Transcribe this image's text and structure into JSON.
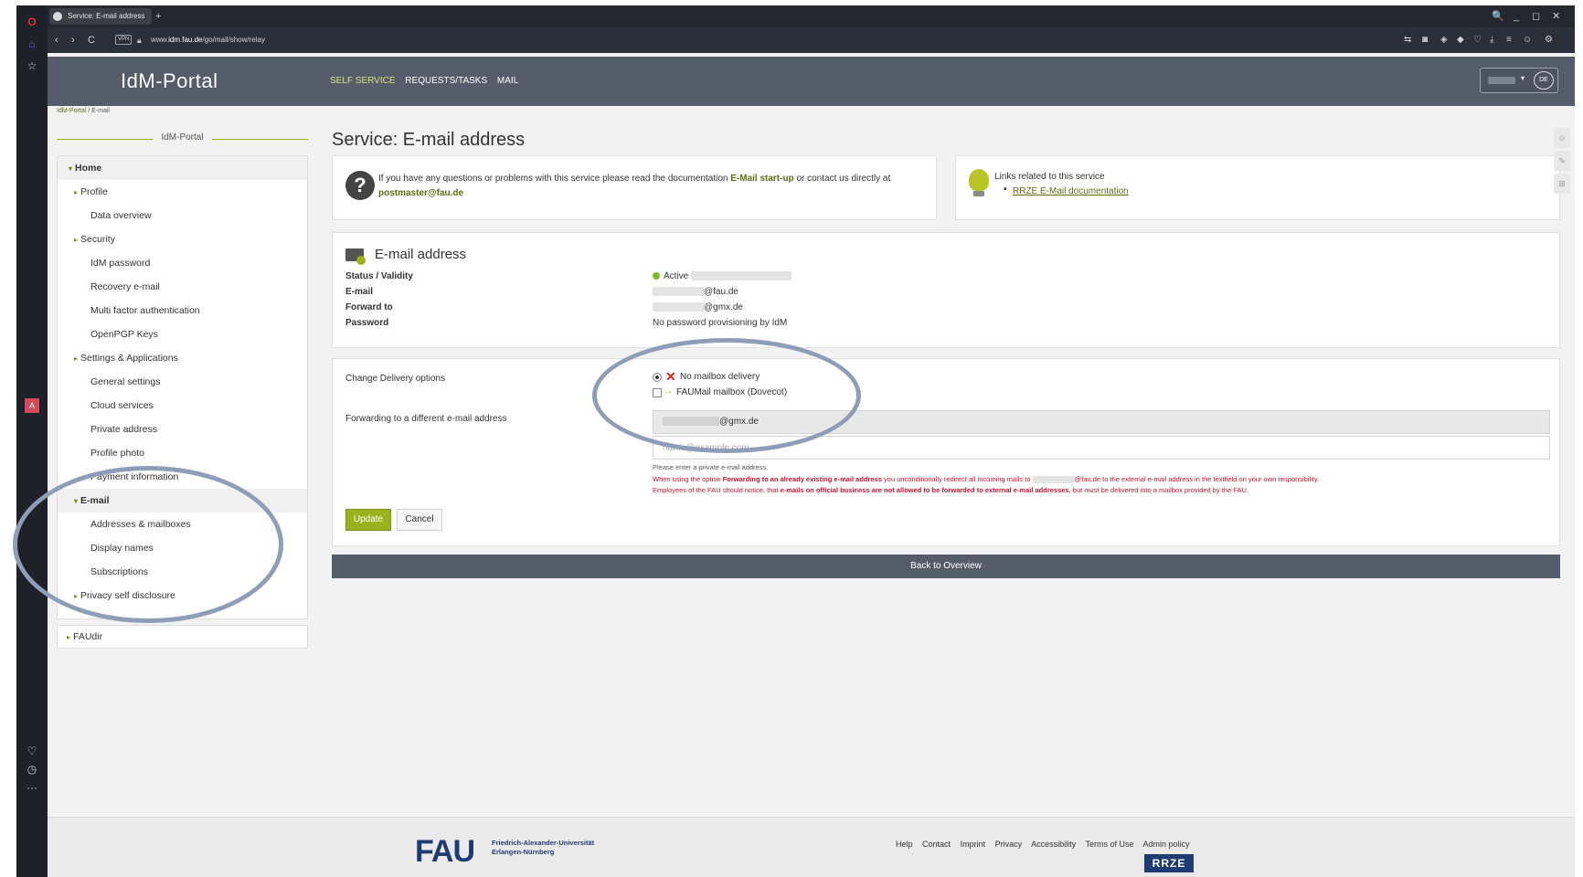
{
  "browser": {
    "tab_title": "Service: E-mail address",
    "new_tab_symbol": "+",
    "url_prefix": "www.",
    "url_host": "idm.fau.de",
    "url_path": "/go/mail/show/relay",
    "vpn_label": "VPN",
    "window_controls": [
      "🔍",
      "_",
      "◻",
      "✕"
    ],
    "nav": {
      "back": "‹",
      "forward": "›",
      "reload": "C"
    }
  },
  "header": {
    "logo": "IdM-Portal",
    "nav": [
      "SELF SERVICE",
      "REQUESTS/TASKS",
      "MAIL"
    ],
    "active_nav": "SELF SERVICE",
    "lang_code": "DE",
    "lang_arrow": "▾"
  },
  "breadcrumb": {
    "home": "IdM-Portal",
    "separator": " / ",
    "current": "E-mail"
  },
  "sidebar": {
    "title": "IdM-Portal",
    "items": [
      {
        "label": "Home",
        "level": 0,
        "caret": "▾"
      },
      {
        "label": "Profile",
        "level": 1,
        "caret": "▸"
      },
      {
        "label": "Data overview",
        "level": 2
      },
      {
        "label": "Security",
        "level": 1,
        "caret": "▸"
      },
      {
        "label": "IdM password",
        "level": 2
      },
      {
        "label": "Recovery e-mail",
        "level": 2
      },
      {
        "label": "Multi factor authentication",
        "level": 2
      },
      {
        "label": "OpenPGP Keys",
        "level": 2
      },
      {
        "label": "Settings & Applications",
        "level": 1,
        "caret": "▸"
      },
      {
        "label": "General settings",
        "level": 2
      },
      {
        "label": "Cloud services",
        "level": 2
      },
      {
        "label": "Private address",
        "level": 2
      },
      {
        "label": "Profile photo",
        "level": 2
      },
      {
        "label": "Payment information",
        "level": 2
      },
      {
        "label": "E-mail",
        "level": 1,
        "caret": "▾",
        "selected": true
      },
      {
        "label": "Addresses & mailboxes",
        "level": 2
      },
      {
        "label": "Display names",
        "level": 2
      },
      {
        "label": "Subscriptions",
        "level": 2
      },
      {
        "label": "Privacy self disclosure",
        "level": 1,
        "caret": "▸"
      }
    ],
    "faudir": {
      "label": "FAUdir",
      "caret": "▸"
    }
  },
  "main": {
    "title": "Service: E-mail address",
    "help_icon": "?",
    "info": {
      "text_before": "If you have any questions or problems with this service please read the documentation ",
      "doc_link": "E-Mail start-up",
      "text_mid": " or contact us directly at ",
      "contact_link": "postmaster@fau.de"
    },
    "links": {
      "title": "Links related to this service",
      "bullet": "•",
      "items": [
        "RRZE E-Mail documentation"
      ]
    },
    "details": {
      "title": "E-mail address",
      "rows": [
        {
          "label": "Status / Validity",
          "value": "Active"
        },
        {
          "label": "E-mail",
          "value": "@fau.de"
        },
        {
          "label": "Forward to",
          "value": "@gmx.de"
        },
        {
          "label": "Password",
          "value": "No password provisioning by IdM"
        }
      ]
    },
    "delivery": {
      "label": "Change Delivery options",
      "option_no_mailbox": "No mailbox delivery",
      "option_faumail": "FAUMail mailbox (Dovecot)",
      "no_mailbox_selected": true,
      "faumail_checked": false,
      "forward_label": "Forwarding to a different e-mail address",
      "forward_existing": "@gmx.de",
      "forward_placeholder": "name@example.com",
      "hint": "Please enter a private e-mail address.",
      "warning_1a": "When using the option ",
      "warning_1b": "Forwarding to an already existing e-mail address",
      "warning_1c": " you unconditionally redirect all incoming mails to",
      "warning_1d": "@fau.de to the external e-mail address in the textfield on your own responsibility.",
      "warning_2a": "Employees of the FAU should notice, that ",
      "warning_2b": "e-mails on official business are not allowed to be forwarded to external e-mail addresses",
      "warning_2c": ", but must be delivered into a mailbox provided by the FAU.",
      "update_button": "Update",
      "cancel_button": "Cancel"
    },
    "back_button": "Back to Overview"
  },
  "footer": {
    "logo": "FAU",
    "university_line1": "Friedrich-Alexander-Universität",
    "university_line2": "Erlangen-Nürnberg",
    "links": [
      "Help",
      "Contact",
      "Imprint",
      "Privacy",
      "Accessibility",
      "Terms of Use",
      "Admin policy"
    ],
    "rrze": "RRZE"
  },
  "colors": {
    "accent": "#9ab21e",
    "header": "#555d6b",
    "warning": "#c8102e",
    "annotation": "#8e9db8"
  }
}
